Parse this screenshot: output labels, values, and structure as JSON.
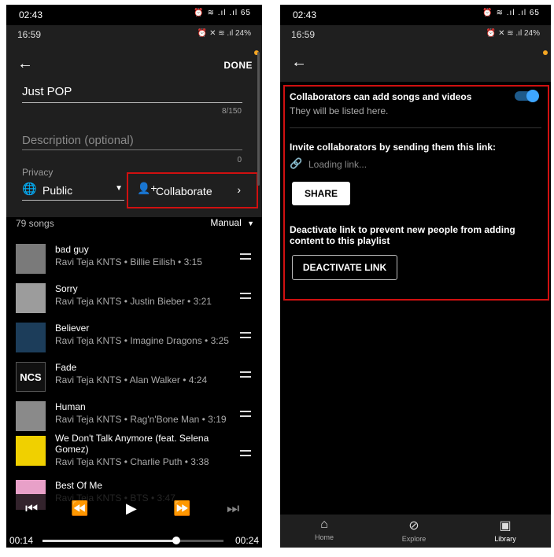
{
  "left": {
    "status_time_1": "02:43",
    "status_icons_1": "⏰ ≋ .ıl .ıl 65",
    "status_time_2": "16:59",
    "status_icons_2": "⏰ ✕ ≋ .ıl 24%",
    "done_label": "DONE",
    "playlist_title": "Just POP",
    "title_counter": "8/150",
    "description_placeholder": "Description (optional)",
    "description_counter": "0",
    "privacy_label": "Privacy",
    "privacy_value": "Public",
    "collaborate_label": "Collaborate",
    "song_count": "79 songs",
    "sort_label": "Manual",
    "songs": [
      {
        "title": "bad guy",
        "subtitle": "Ravi Teja KNTS • Billie Eilish • 3:15",
        "color": "#7a7a7a"
      },
      {
        "title": "Sorry",
        "subtitle": "Ravi Teja KNTS • Justin Bieber • 3:21",
        "color": "#9c9c9c"
      },
      {
        "title": "Believer",
        "subtitle": "Ravi Teja KNTS • Imagine Dragons • 3:25",
        "color": "#1c3d5a"
      },
      {
        "title": "Fade",
        "subtitle": "Ravi Teja KNTS • Alan Walker • 4:24",
        "color": "#111111",
        "thumb_text": "NCS"
      },
      {
        "title": "Human",
        "subtitle": "Ravi Teja KNTS • Rag'n'Bone Man • 3:19",
        "color": "#8a8a8a"
      },
      {
        "title": "We Don't Talk Anymore (feat. Selena Gomez)",
        "subtitle": "Ravi Teja KNTS • Charlie Puth • 3:38",
        "color": "#f0d000"
      },
      {
        "title": "Best Of Me",
        "subtitle": "Ravi Teja KNTS • BTS • 3:47",
        "color": "#e8a0c8"
      }
    ],
    "elapsed": "00:14",
    "duration": "00:24",
    "playback_progress": 0.74
  },
  "right": {
    "status_time_1": "02:43",
    "status_icons_1": "⏰ ≋ .ıl .ıl 65",
    "status_time_2": "16:59",
    "status_icons_2": "⏰ ✕ ≋ .ıl 24%",
    "collab_title": "Collaborators can add songs and videos",
    "collab_sub": "They will be listed here.",
    "toggle_on": true,
    "invite_text": "Invite collaborators by sending them this link:",
    "loading_text": "Loading link...",
    "share_label": "SHARE",
    "deactivate_text_1": "Deactivate link to prevent new people from adding",
    "deactivate_text_2": "content to this playlist",
    "deactivate_label": "DEACTIVATE LINK",
    "nav": [
      {
        "label": "Home",
        "icon": "home-icon"
      },
      {
        "label": "Explore",
        "icon": "compass-icon"
      },
      {
        "label": "Library",
        "icon": "library-icon"
      }
    ]
  },
  "colors": {
    "accent_red": "#d01010",
    "toggle_blue": "#3ea6ff",
    "notify_dot": "#f5a623"
  }
}
